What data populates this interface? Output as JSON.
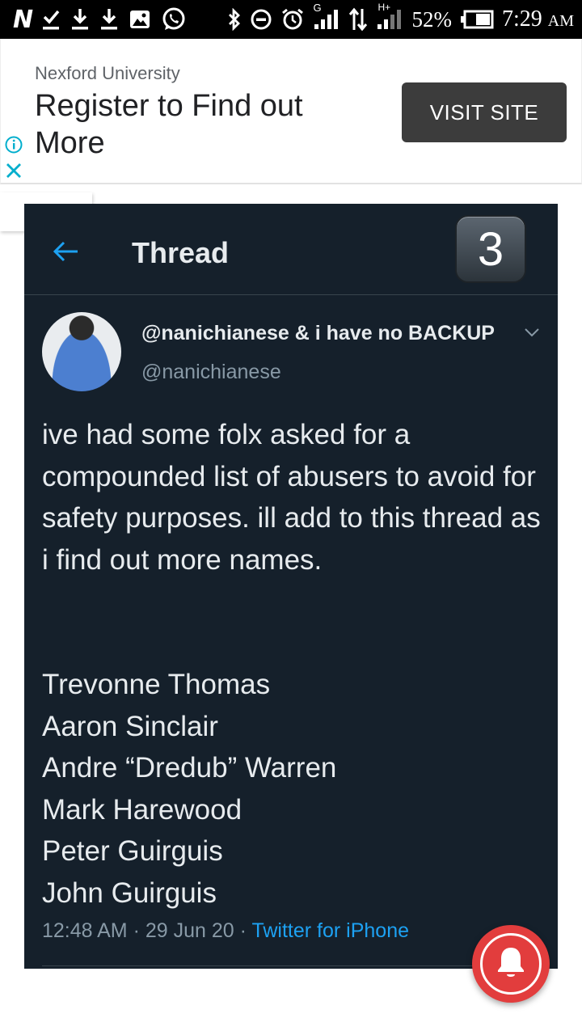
{
  "status_bar": {
    "network_label": "N",
    "sim_label": "G",
    "network_type": "H+",
    "battery_percent": "52%",
    "time": "7:29",
    "time_suffix": "AM"
  },
  "ad": {
    "advertiser": "Nexford University",
    "headline": "Register to Find out More",
    "button_label": "VISIT SITE"
  },
  "tweet": {
    "header_title": "Thread",
    "badge": "3",
    "display_name": "@nanichianese & i have no BACKUP",
    "handle": "@nanichianese",
    "text": "ive had some folx asked for a compounded list of abusers to avoid for safety purposes. ill add to this thread as i find out more names.",
    "names": [
      "Trevonne Thomas",
      "Aaron Sinclair",
      "Andre “Dredub” Warren",
      "Mark Harewood",
      "Peter Guirguis",
      "John Guirguis"
    ],
    "time": "12:48 AM",
    "date": "29 Jun 20",
    "separator": "·",
    "source": "Twitter for iPhone"
  },
  "colors": {
    "tweet_bg": "#15202b",
    "accent_blue": "#1da1f2",
    "bell_red": "#e23d3d",
    "ad_button": "#3c3c3c"
  }
}
